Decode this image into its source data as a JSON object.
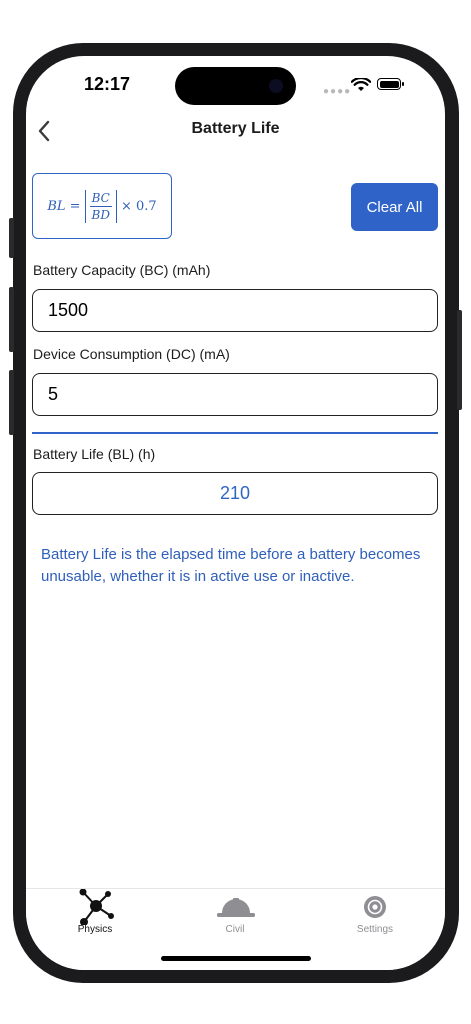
{
  "status_bar": {
    "time": "12:17"
  },
  "nav": {
    "title": "Battery Life"
  },
  "formula": {
    "lhs": "BL =",
    "numerator": "BC",
    "denominator": "BD",
    "multiplier": "× 0.7"
  },
  "toolbar": {
    "clear_label": "Clear All"
  },
  "fields": {
    "capacity": {
      "label": "Battery Capacity (BC) (mAh)",
      "value": "1500"
    },
    "consumption": {
      "label": "Device Consumption (DC) (mA)",
      "value": "5"
    },
    "result": {
      "label": "Battery Life (BL) (h)",
      "value": "210"
    }
  },
  "description": "Battery Life is the elapsed time before a battery becomes unusable, whether it is in active use or inactive.",
  "tabs": [
    {
      "label": "Physics",
      "icon": "molecule-icon",
      "active": true
    },
    {
      "label": "Civil",
      "icon": "hard-hat-icon",
      "active": false
    },
    {
      "label": "Settings",
      "icon": "gear-icon",
      "active": false
    }
  ],
  "colors": {
    "accent": "#2f63c8",
    "result_text": "#2f66c4",
    "inactive_tab": "#8e8e93"
  }
}
